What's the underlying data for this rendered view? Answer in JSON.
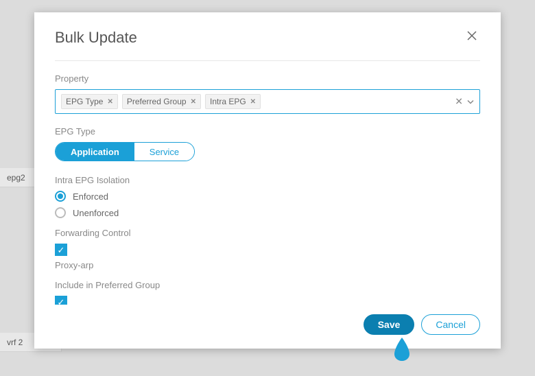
{
  "background": {
    "row1_label": "epg2",
    "row2_label": "vrf 2"
  },
  "modal": {
    "title": "Bulk Update",
    "property_label": "Property",
    "tags": [
      {
        "label": "EPG Type"
      },
      {
        "label": "Preferred Group"
      },
      {
        "label": "Intra EPG"
      }
    ],
    "epg_type": {
      "label": "EPG Type",
      "options": [
        {
          "label": "Application",
          "active": true
        },
        {
          "label": "Service",
          "active": false
        }
      ]
    },
    "intra_epg": {
      "label": "Intra EPG Isolation",
      "options": [
        {
          "label": "Enforced",
          "selected": true
        },
        {
          "label": "Unenforced",
          "selected": false
        }
      ]
    },
    "forwarding_control": {
      "label": "Forwarding Control",
      "checked": true,
      "sub_label": "Proxy-arp"
    },
    "preferred_group": {
      "label": "Include in Preferred Group",
      "checked": true
    },
    "buttons": {
      "save": "Save",
      "cancel": "Cancel"
    }
  }
}
